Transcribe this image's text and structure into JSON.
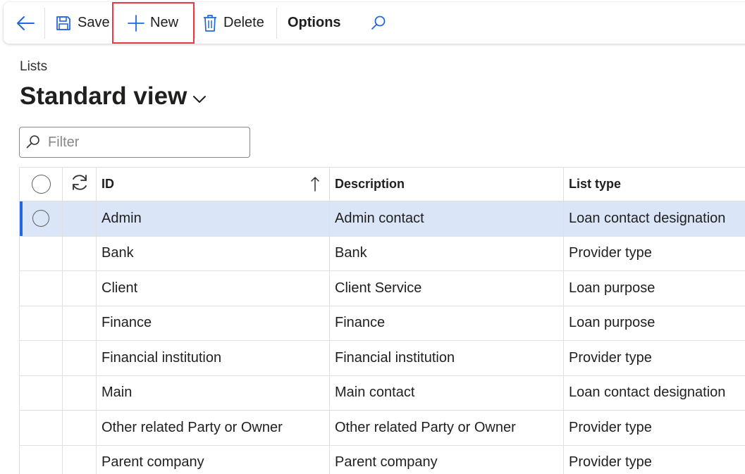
{
  "toolbar": {
    "back_label": "",
    "save_label": "Save",
    "new_label": "New",
    "delete_label": "Delete",
    "options_label": "Options"
  },
  "breadcrumb": "Lists",
  "view": {
    "title": "Standard view"
  },
  "filter": {
    "placeholder": "Filter",
    "value": ""
  },
  "grid": {
    "columns": [
      "ID",
      "Description",
      "List type"
    ],
    "sorted_column": "ID",
    "sort_direction": "ascending",
    "rows": [
      {
        "id": "Admin",
        "description": "Admin contact",
        "list_type": "Loan contact designation",
        "selected": true
      },
      {
        "id": "Bank",
        "description": "Bank",
        "list_type": "Provider type",
        "selected": false
      },
      {
        "id": "Client",
        "description": "Client Service",
        "list_type": "Loan purpose",
        "selected": false
      },
      {
        "id": "Finance",
        "description": "Finance",
        "list_type": "Loan purpose",
        "selected": false
      },
      {
        "id": "Financial institution",
        "description": "Financial institution",
        "list_type": "Provider type",
        "selected": false
      },
      {
        "id": "Main",
        "description": "Main contact",
        "list_type": "Loan contact designation",
        "selected": false
      },
      {
        "id": "Other related Party or Owner",
        "description": "Other related Party or Owner",
        "list_type": "Provider type",
        "selected": false
      },
      {
        "id": "Parent company",
        "description": "Parent company",
        "list_type": "Provider type",
        "selected": false
      }
    ]
  },
  "icons": {
    "back": "arrow-left-icon",
    "save": "floppy-disk-icon",
    "new": "plus-icon",
    "delete": "trash-icon",
    "search": "magnifier-icon",
    "view_menu": "chevron-down-icon",
    "refresh": "refresh-icon",
    "sort": "arrow-up-icon"
  },
  "colors": {
    "accent": "#2266e3",
    "selected_row": "#dae5f8",
    "highlight_box": "#e83a45"
  }
}
